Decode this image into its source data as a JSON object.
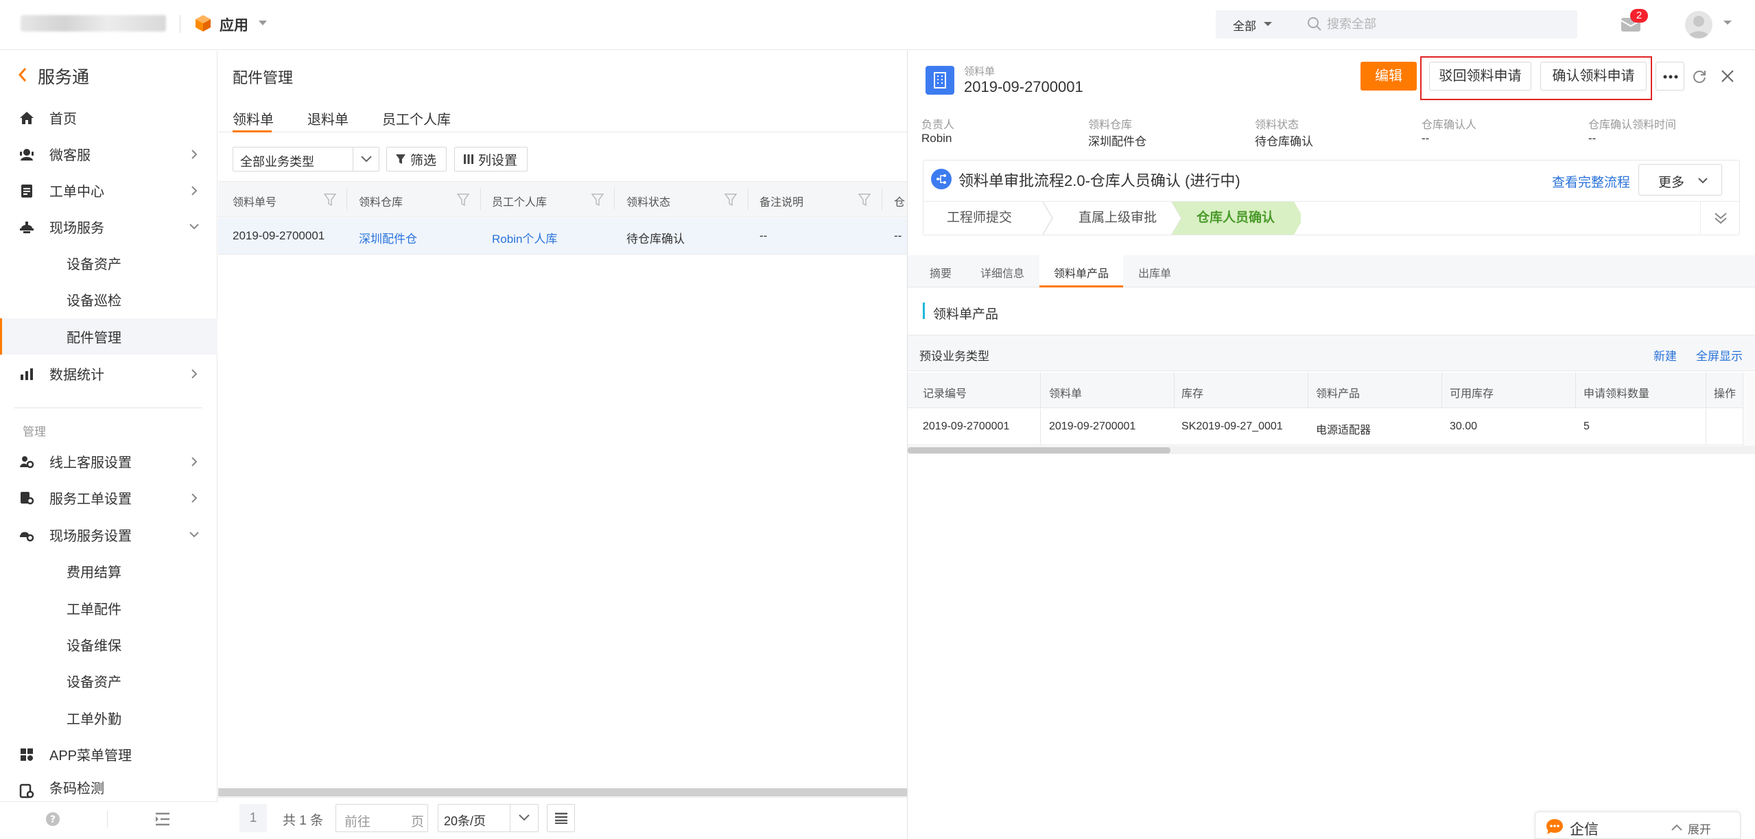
{
  "header": {
    "app_label": "应用",
    "search_scope": "全部",
    "search_placeholder": "搜索全部",
    "message_count": "2"
  },
  "sidebar": {
    "title": "服务通",
    "items": [
      {
        "label": "首页",
        "icon": "home-icon"
      },
      {
        "label": "微客服",
        "icon": "customer-service-icon"
      },
      {
        "label": "工单中心",
        "icon": "ticket-icon"
      },
      {
        "label": "现场服务",
        "icon": "field-service-icon"
      },
      {
        "label": "设备资产"
      },
      {
        "label": "设备巡检"
      },
      {
        "label": "配件管理"
      },
      {
        "label": "数据统计",
        "icon": "chart-icon"
      }
    ],
    "section_label": "管理",
    "manage_items": [
      {
        "label": "线上客服设置",
        "icon": "settings-icon"
      },
      {
        "label": "服务工单设置",
        "icon": "settings-icon"
      },
      {
        "label": "现场服务设置",
        "icon": "settings-icon"
      },
      {
        "label": "费用结算"
      },
      {
        "label": "工单配件"
      },
      {
        "label": "设备维保"
      },
      {
        "label": "设备资产"
      },
      {
        "label": "工单外勤"
      },
      {
        "label": "APP菜单管理",
        "icon": "app-menu-icon"
      },
      {
        "label": "条码检测",
        "icon": "barcode-icon"
      }
    ]
  },
  "middle": {
    "title": "配件管理",
    "tabs": [
      "领料单",
      "退料单",
      "员工个人库"
    ],
    "type_filter": "全部业务类型",
    "filter_label": "筛选",
    "columns_label": "列设置",
    "columns": [
      "领料单号",
      "领料仓库",
      "员工个人库",
      "领料状态",
      "备注说明",
      "仓"
    ],
    "rows": [
      {
        "no": "2019-09-2700001",
        "warehouse": "深圳配件仓",
        "personal": "Robin个人库",
        "status": "待仓库确认",
        "note": "--",
        "more": "--"
      }
    ],
    "pager": {
      "current": "1",
      "total": "共 1 条",
      "goto_prefix": "前往",
      "goto_suffix": "页",
      "page_size": "20条/页"
    }
  },
  "detail": {
    "doc_kind": "领料单",
    "doc_no": "2019-09-2700001",
    "edit_label": "编辑",
    "reject_label": "驳回领料申请",
    "confirm_label": "确认领料申请",
    "fields": [
      {
        "label": "负责人",
        "value": "Robin"
      },
      {
        "label": "领料仓库",
        "value": "深圳配件仓"
      },
      {
        "label": "领料状态",
        "value": "待仓库确认"
      },
      {
        "label": "仓库确认人",
        "value": "--"
      },
      {
        "label": "仓库确认领料时间",
        "value": "--"
      }
    ],
    "flow": {
      "title": "领料单审批流程2.0-仓库人员确认 (进行中)",
      "view_link": "查看完整流程",
      "more_label": "更多",
      "steps": [
        "工程师提交",
        "直属上级审批",
        "仓库人员确认"
      ]
    },
    "tabs": [
      "摘要",
      "详细信息",
      "领料单产品",
      "出库单"
    ],
    "section_title": "领料单产品",
    "sub_title": "预设业务类型",
    "new_label": "新建",
    "fullscreen_label": "全屏显示",
    "product_columns": [
      "记录编号",
      "领料单",
      "库存",
      "领料产品",
      "可用库存",
      "申请领料数量",
      "操作"
    ],
    "product_rows": [
      {
        "record": "2019-09-2700001",
        "order": "2019-09-2700001",
        "stock": "SK2019-09-27_0001",
        "product": "电源适配器",
        "available": "30.00",
        "qty": "5"
      }
    ]
  },
  "chat": {
    "label": "企信",
    "expand_label": "展开"
  },
  "colors": {
    "accent": "#ff7a00",
    "link": "#2a73d9",
    "highlight": "#e02424",
    "flow_active": "#d9f0c4"
  }
}
